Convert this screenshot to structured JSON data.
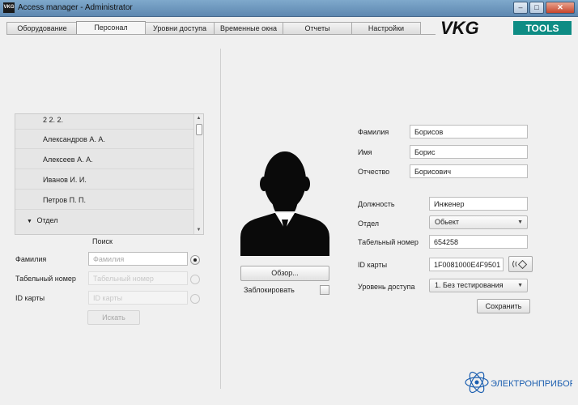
{
  "window": {
    "app_icon_text": "VKG",
    "title": "Access manager - Administrator",
    "min_glyph": "–",
    "max_glyph": "□",
    "close_glyph": "✕"
  },
  "tabs": [
    {
      "label": "Оборудование",
      "active": false
    },
    {
      "label": "Персонал",
      "active": true
    },
    {
      "label": "Уровни доступа",
      "active": false
    },
    {
      "label": "Временные окна",
      "active": false
    },
    {
      "label": "Отчеты",
      "active": false
    },
    {
      "label": "Настройки",
      "active": false
    }
  ],
  "logo": {
    "brand": "VKG",
    "suffix": "TOOLS"
  },
  "employee_list": {
    "items": [
      "2 2. 2.",
      "Александров А. А.",
      "Алексеев А. А.",
      "Иванов И. И.",
      "Петров П. П."
    ],
    "group": "Отдел",
    "group_toggle": "▼"
  },
  "search": {
    "title": "Поиск",
    "fields": [
      {
        "label": "Фамилия",
        "placeholder": "Фамилия",
        "selected": true
      },
      {
        "label": "Табельный номер",
        "placeholder": "Табельный номер",
        "selected": false
      },
      {
        "label": "ID карты",
        "placeholder": "ID карты",
        "selected": false
      }
    ],
    "button": "Искать"
  },
  "photo": {
    "browse_button": "Обзор...",
    "block_label": "Заблокировать",
    "blocked": false
  },
  "details": {
    "last_name": {
      "label": "Фамилия",
      "value": "Борисов"
    },
    "first_name": {
      "label": "Имя",
      "value": "Борис"
    },
    "patronymic": {
      "label": "Отчество",
      "value": "Борисович"
    },
    "position": {
      "label": "Должность",
      "value": "Инженер"
    },
    "department": {
      "label": "Отдел",
      "value": "Обьект"
    },
    "personnel_number": {
      "label": "Табельный номер",
      "value": "654258"
    },
    "card_id": {
      "label": "ID карты",
      "value": "1F0081000E4F9501"
    },
    "access_level": {
      "label": "Уровень доступа",
      "value": "1. Без тестирования"
    },
    "save_button": "Сохранить"
  },
  "footer_brand": "ЭЛЕКТРОНПРИБОР",
  "colors": {
    "titlebar": "#6b95be",
    "list_bg": "#e6e6e6",
    "logo_tools": "#0e8c84",
    "brand_blue": "#1c5fb0"
  }
}
